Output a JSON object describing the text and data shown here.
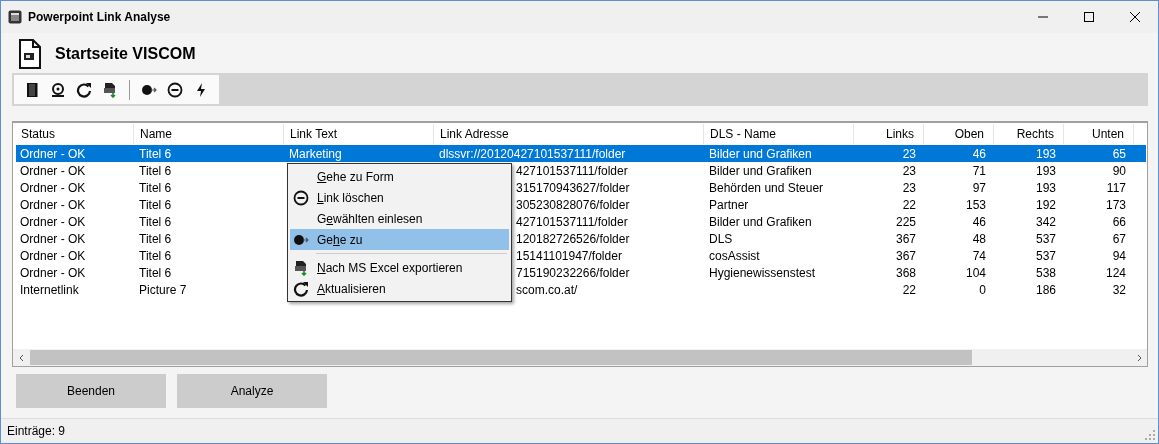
{
  "window": {
    "title": "Powerpoint Link Analyse"
  },
  "page_title": "Startseite VISCOM",
  "table": {
    "columns": [
      "Status",
      "Name",
      "Link Text",
      "Link Adresse",
      "DLS - Name",
      "Links",
      "Oben",
      "Rechts",
      "Unten"
    ],
    "rows": [
      {
        "selected": true,
        "status": "Ordner - OK",
        "name": "Titel 6",
        "link_text": "Marketing",
        "link_address": "dlssvr://20120427101537111/folder",
        "dls_name": "Bilder und Grafiken",
        "links": "23",
        "oben": "46",
        "rechts": "193",
        "unten": "65"
      },
      {
        "selected": false,
        "status": "Ordner - OK",
        "name": "Titel 6",
        "link_address": "427101537111/folder",
        "dls_name": "Bilder und Grafiken",
        "links": "23",
        "oben": "71",
        "rechts": "193",
        "unten": "90"
      },
      {
        "selected": false,
        "status": "Ordner - OK",
        "name": "Titel 6",
        "link_address": "315170943627/folder",
        "dls_name": "Behörden und Steuer",
        "links": "23",
        "oben": "97",
        "rechts": "193",
        "unten": "117"
      },
      {
        "selected": false,
        "status": "Ordner - OK",
        "name": "Titel 6",
        "link_address": "305230828076/folder",
        "dls_name": "Partner",
        "links": "22",
        "oben": "153",
        "rechts": "192",
        "unten": "173"
      },
      {
        "selected": false,
        "status": "Ordner - OK",
        "name": "Titel 6",
        "link_address": "427101537111/folder",
        "dls_name": "Bilder und Grafiken",
        "links": "225",
        "oben": "46",
        "rechts": "342",
        "unten": "66"
      },
      {
        "selected": false,
        "status": "Ordner - OK",
        "name": "Titel 6",
        "link_address": "120182726526/folder",
        "dls_name": "DLS",
        "links": "367",
        "oben": "48",
        "rechts": "537",
        "unten": "67"
      },
      {
        "selected": false,
        "status": "Ordner - OK",
        "name": "Titel 6",
        "link_address": "15141101947/folder",
        "dls_name": "cosAssist",
        "links": "367",
        "oben": "74",
        "rechts": "537",
        "unten": "94"
      },
      {
        "selected": false,
        "status": "Ordner - OK",
        "name": "Titel 6",
        "link_address": "715190232266/folder",
        "dls_name": "Hygienewissenstest",
        "links": "368",
        "oben": "104",
        "rechts": "538",
        "unten": "124"
      },
      {
        "selected": false,
        "status": "Internetlink",
        "name": "Picture 7",
        "link_address": "scom.co.at/",
        "links": "22",
        "oben": "0",
        "rechts": "186",
        "unten": "32"
      }
    ]
  },
  "context_menu": [
    {
      "kind": "item",
      "selected": false,
      "label": {
        "accel": "G",
        "after": "ehe zu Form"
      }
    },
    {
      "kind": "item",
      "selected": false,
      "label": {
        "accel": "L",
        "after": "ink löschen"
      }
    },
    {
      "kind": "item",
      "selected": false,
      "label": {
        "before": "G",
        "accel": "e",
        "after": "wählten einlesen"
      }
    },
    {
      "kind": "item",
      "selected": true,
      "label": {
        "before": "Ge",
        "accel": "h",
        "after": "e zu"
      }
    },
    {
      "kind": "separator"
    },
    {
      "kind": "item",
      "selected": false,
      "label": {
        "accel": "N",
        "after": "ach MS Excel exportieren"
      }
    },
    {
      "kind": "item",
      "selected": false,
      "label": {
        "accel": "A",
        "after": "ktualisieren"
      }
    }
  ],
  "buttons": [
    "Beenden",
    "Analyze"
  ],
  "status_bar": "Einträge: 9"
}
